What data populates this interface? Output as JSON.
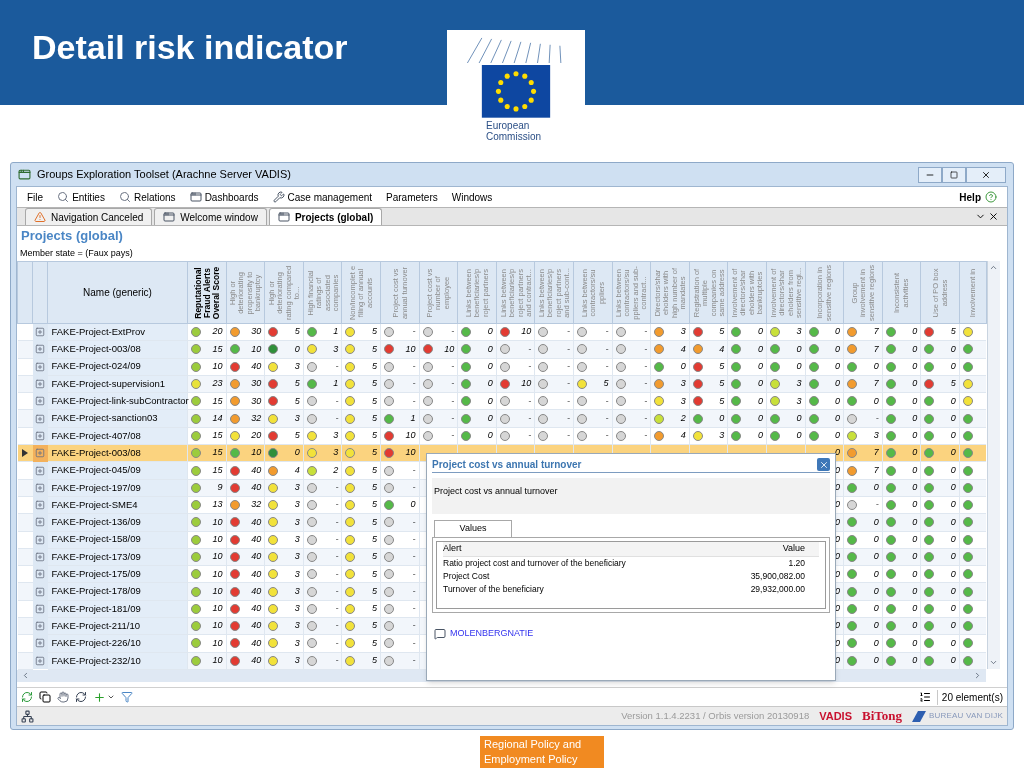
{
  "slide": {
    "title": "Detail risk indicator",
    "logo_text": "European Commission",
    "footer": "Regional Policy and Employment Policy"
  },
  "window": {
    "title": "Groups Exploration Toolset (Arachne Server VADIS)"
  },
  "menu": [
    {
      "label": "File",
      "kind": "plain"
    },
    {
      "label": "Entities",
      "kind": "search"
    },
    {
      "label": "Relations",
      "kind": "search"
    },
    {
      "label": "Dashboards",
      "kind": "window"
    },
    {
      "label": "Case management",
      "kind": "tools"
    },
    {
      "label": "Parameters",
      "kind": "plain"
    },
    {
      "label": "Windows",
      "kind": "plain"
    }
  ],
  "help": "Help",
  "tabs": [
    {
      "label": "Navigation Canceled",
      "kind": "alert",
      "selected": false
    },
    {
      "label": "Welcome window",
      "kind": "window",
      "selected": false
    },
    {
      "label": "Projects (global)",
      "kind": "window",
      "selected": true
    }
  ],
  "view": {
    "title": "Projects (global)",
    "filter": "Member state = (Faux pays)"
  },
  "table": {
    "name_column": "Name (generic)",
    "columns": [
      {
        "label": "Reputational Fraud Alerts Overal Score",
        "kind": "score"
      },
      {
        "label": "High or deteriorating propensity to bankruptcy",
        "kind": "indicator"
      },
      {
        "label": "High or deteriorating rating compared to...",
        "kind": "indicator"
      },
      {
        "label": "High financial ratings of associated companies",
        "kind": "indicator"
      },
      {
        "label": "Non/incomplet e filing of annual accounts",
        "kind": "indicator"
      },
      {
        "label": "Project cost vs annual turnover",
        "kind": "indicator"
      },
      {
        "label": "Project cost vs number of employee",
        "kind": "indicator"
      },
      {
        "label": "Links between beneficiaries/p roject partners",
        "kind": "indicator"
      },
      {
        "label": "Links between beneficiaries/p roject partners and contract...",
        "kind": "indicator"
      },
      {
        "label": "Links between beneficiaries/p roject partners and sub-cont...",
        "kind": "indicator"
      },
      {
        "label": "Links between contractors/su ppliers",
        "kind": "indicator"
      },
      {
        "label": "Links between contractors/su ppliers and sub-contract...",
        "kind": "indicator"
      },
      {
        "label": "Directors/shar eholders with high number of mandates",
        "kind": "indicator"
      },
      {
        "label": "Registration of multiple companies on same address",
        "kind": "indicator"
      },
      {
        "label": "Involvement of directors/shar eholders with bankruptcies",
        "kind": "indicator"
      },
      {
        "label": "Involvement of directors/shar eholders from sensitive regi...",
        "kind": "indicator"
      },
      {
        "label": "Incorporation in sensitive regions",
        "kind": "indicator"
      },
      {
        "label": "Group involvement in sensitive regions",
        "kind": "indicator"
      },
      {
        "label": "Inconsistent activities",
        "kind": "indicator"
      },
      {
        "label": "Use of PO box address",
        "kind": "indicator"
      },
      {
        "label": "Involvement in",
        "kind": "indicator"
      }
    ],
    "rows": [
      {
        "name": "FAKE-Project-ExtProv",
        "selected": false,
        "cells": [
          {
            "color": "#9ccc3c",
            "value": "20"
          },
          {
            "color": "#f29b2e",
            "value": "30"
          },
          {
            "color": "#e23b32",
            "value": "5"
          },
          {
            "color": "#55b948",
            "value": "1"
          },
          {
            "color": "#f2e23a",
            "value": "5"
          },
          {
            "color": "#d6d6d6",
            "value": "-"
          },
          {
            "color": "#d6d6d6",
            "value": "-"
          },
          {
            "color": "#55b948",
            "value": "0"
          },
          {
            "color": "#e23b32",
            "value": "10"
          },
          {
            "color": "#d6d6d6",
            "value": "-"
          },
          {
            "color": "#d6d6d6",
            "value": "-"
          },
          {
            "color": "#d6d6d6",
            "value": "-"
          },
          {
            "color": "#f29b2e",
            "value": "3"
          },
          {
            "color": "#e23b32",
            "value": "5"
          },
          {
            "color": "#55b948",
            "value": "0"
          },
          {
            "color": "#c8e03a",
            "value": "3"
          },
          {
            "color": "#55b948",
            "value": "0"
          },
          {
            "color": "#f29b2e",
            "value": "7"
          },
          {
            "color": "#55b948",
            "value": "0"
          },
          {
            "color": "#e23b32",
            "value": "5"
          },
          {
            "color": "#f2e23a"
          }
        ]
      },
      {
        "name": "FAKE-Project-003/08",
        "selected": false,
        "cells": [
          {
            "color": "#9ccc3c",
            "value": "15"
          },
          {
            "color": "#55b948",
            "value": "10"
          },
          {
            "color": "#2f8f3a",
            "value": "0"
          },
          {
            "color": "#f2e23a",
            "value": "3"
          },
          {
            "color": "#f2e23a",
            "value": "5"
          },
          {
            "color": "#e23b32",
            "value": "10"
          },
          {
            "color": "#e23b32",
            "value": "10"
          },
          {
            "color": "#55b948",
            "value": "0"
          },
          {
            "color": "#d6d6d6",
            "value": "-"
          },
          {
            "color": "#d6d6d6",
            "value": "-"
          },
          {
            "color": "#d6d6d6",
            "value": "-"
          },
          {
            "color": "#d6d6d6",
            "value": "-"
          },
          {
            "color": "#f29b2e",
            "value": "4"
          },
          {
            "color": "#f29b2e",
            "value": "4"
          },
          {
            "color": "#55b948",
            "value": "0"
          },
          {
            "color": "#55b948",
            "value": "0"
          },
          {
            "color": "#55b948",
            "value": "0"
          },
          {
            "color": "#f29b2e",
            "value": "7"
          },
          {
            "color": "#55b948",
            "value": "0"
          },
          {
            "color": "#55b948",
            "value": "0"
          },
          {
            "color": "#55b948"
          }
        ]
      },
      {
        "name": "FAKE-Project-024/09",
        "selected": false,
        "cells": [
          {
            "color": "#9ccc3c",
            "value": "10"
          },
          {
            "color": "#e23b32",
            "value": "40"
          },
          {
            "color": "#f2e23a",
            "value": "3"
          },
          {
            "color": "#d6d6d6",
            "value": "-"
          },
          {
            "color": "#f2e23a",
            "value": "5"
          },
          {
            "color": "#d6d6d6",
            "value": "-"
          },
          {
            "color": "#d6d6d6",
            "value": "-"
          },
          {
            "color": "#55b948",
            "value": "0"
          },
          {
            "color": "#d6d6d6",
            "value": "-"
          },
          {
            "color": "#d6d6d6",
            "value": "-"
          },
          {
            "color": "#d6d6d6",
            "value": "-"
          },
          {
            "color": "#d6d6d6",
            "value": "-"
          },
          {
            "color": "#55b948",
            "value": "0"
          },
          {
            "color": "#e23b32",
            "value": "5"
          },
          {
            "color": "#55b948",
            "value": "0"
          },
          {
            "color": "#55b948",
            "value": "0"
          },
          {
            "color": "#55b948",
            "value": "0"
          },
          {
            "color": "#55b948",
            "value": "0"
          },
          {
            "color": "#55b948",
            "value": "0"
          },
          {
            "color": "#55b948",
            "value": "0"
          },
          {
            "color": "#55b948"
          }
        ]
      },
      {
        "name": "FAKE-Project-supervision1",
        "selected": false,
        "cells": [
          {
            "color": "#e8e23a",
            "value": "23"
          },
          {
            "color": "#f29b2e",
            "value": "30"
          },
          {
            "color": "#e23b32",
            "value": "5"
          },
          {
            "color": "#55b948",
            "value": "1"
          },
          {
            "color": "#f2e23a",
            "value": "5"
          },
          {
            "color": "#d6d6d6",
            "value": "-"
          },
          {
            "color": "#d6d6d6",
            "value": "-"
          },
          {
            "color": "#55b948",
            "value": "0"
          },
          {
            "color": "#e23b32",
            "value": "10"
          },
          {
            "color": "#d6d6d6",
            "value": "-"
          },
          {
            "color": "#f2e23a",
            "value": "5"
          },
          {
            "color": "#d6d6d6",
            "value": "-"
          },
          {
            "color": "#f29b2e",
            "value": "3"
          },
          {
            "color": "#e23b32",
            "value": "5"
          },
          {
            "color": "#55b948",
            "value": "0"
          },
          {
            "color": "#c8e03a",
            "value": "3"
          },
          {
            "color": "#55b948",
            "value": "0"
          },
          {
            "color": "#f29b2e",
            "value": "7"
          },
          {
            "color": "#55b948",
            "value": "0"
          },
          {
            "color": "#e23b32",
            "value": "5"
          },
          {
            "color": "#f2e23a"
          }
        ]
      },
      {
        "name": "FAKE-Project-link-subContractor",
        "selected": false,
        "cells": [
          {
            "color": "#9ccc3c",
            "value": "15"
          },
          {
            "color": "#f29b2e",
            "value": "30"
          },
          {
            "color": "#e23b32",
            "value": "5"
          },
          {
            "color": "#d6d6d6",
            "value": "-"
          },
          {
            "color": "#f2e23a",
            "value": "5"
          },
          {
            "color": "#d6d6d6",
            "value": "-"
          },
          {
            "color": "#d6d6d6",
            "value": "-"
          },
          {
            "color": "#55b948",
            "value": "0"
          },
          {
            "color": "#d6d6d6",
            "value": "-"
          },
          {
            "color": "#d6d6d6",
            "value": "-"
          },
          {
            "color": "#d6d6d6",
            "value": "-"
          },
          {
            "color": "#d6d6d6",
            "value": "-"
          },
          {
            "color": "#f2e23a",
            "value": "3"
          },
          {
            "color": "#e23b32",
            "value": "5"
          },
          {
            "color": "#55b948",
            "value": "0"
          },
          {
            "color": "#c8e03a",
            "value": "3"
          },
          {
            "color": "#55b948",
            "value": "0"
          },
          {
            "color": "#55b948",
            "value": "0"
          },
          {
            "color": "#55b948",
            "value": "0"
          },
          {
            "color": "#55b948",
            "value": "0"
          },
          {
            "color": "#f2e23a"
          }
        ]
      },
      {
        "name": "FAKE-Project-sanction03",
        "selected": false,
        "cells": [
          {
            "color": "#9ccc3c",
            "value": "14"
          },
          {
            "color": "#f29b2e",
            "value": "32"
          },
          {
            "color": "#f2e23a",
            "value": "3"
          },
          {
            "color": "#d6d6d6",
            "value": "-"
          },
          {
            "color": "#f2e23a",
            "value": "5"
          },
          {
            "color": "#55b948",
            "value": "1"
          },
          {
            "color": "#d6d6d6",
            "value": "-"
          },
          {
            "color": "#55b948",
            "value": "0"
          },
          {
            "color": "#d6d6d6",
            "value": "-"
          },
          {
            "color": "#d6d6d6",
            "value": "-"
          },
          {
            "color": "#d6d6d6",
            "value": "-"
          },
          {
            "color": "#d6d6d6",
            "value": "-"
          },
          {
            "color": "#c8e03a",
            "value": "2"
          },
          {
            "color": "#55b948",
            "value": "0"
          },
          {
            "color": "#55b948",
            "value": "0"
          },
          {
            "color": "#55b948",
            "value": "0"
          },
          {
            "color": "#55b948",
            "value": "0"
          },
          {
            "color": "#d6d6d6",
            "value": "-"
          },
          {
            "color": "#55b948",
            "value": "0"
          },
          {
            "color": "#55b948",
            "value": "0"
          },
          {
            "color": "#55b948"
          }
        ]
      },
      {
        "name": "FAKE-Project-407/08",
        "selected": false,
        "cells": [
          {
            "color": "#9ccc3c",
            "value": "15"
          },
          {
            "color": "#f2e23a",
            "value": "20"
          },
          {
            "color": "#e23b32",
            "value": "5"
          },
          {
            "color": "#f2e23a",
            "value": "3"
          },
          {
            "color": "#f2e23a",
            "value": "5"
          },
          {
            "color": "#e23b32",
            "value": "10"
          },
          {
            "color": "#d6d6d6",
            "value": "-"
          },
          {
            "color": "#55b948",
            "value": "0"
          },
          {
            "color": "#d6d6d6",
            "value": "-"
          },
          {
            "color": "#d6d6d6",
            "value": "-"
          },
          {
            "color": "#d6d6d6",
            "value": "-"
          },
          {
            "color": "#d6d6d6",
            "value": "-"
          },
          {
            "color": "#f29b2e",
            "value": "4"
          },
          {
            "color": "#f2e23a",
            "value": "3"
          },
          {
            "color": "#55b948",
            "value": "0"
          },
          {
            "color": "#55b948",
            "value": "0"
          },
          {
            "color": "#55b948",
            "value": "0"
          },
          {
            "color": "#c8e03a",
            "value": "3"
          },
          {
            "color": "#55b948",
            "value": "0"
          },
          {
            "color": "#55b948",
            "value": "0"
          },
          {
            "color": "#55b948"
          }
        ]
      },
      {
        "name": "FAKE-Project-003/08",
        "selected": true,
        "cells": [
          {
            "color": "#9ccc3c",
            "value": "15"
          },
          {
            "color": "#55b948",
            "value": "10"
          },
          {
            "color": "#2f8f3a",
            "value": "0"
          },
          {
            "color": "#f2e23a",
            "value": "3"
          },
          {
            "color": "#f2e23a",
            "value": "5"
          },
          {
            "color": "#e23b32",
            "value": "10"
          },
          null,
          null,
          null,
          null,
          null,
          null,
          null,
          null,
          null,
          null,
          {
            "value": "0"
          },
          {
            "color": "#f29b2e",
            "value": "7"
          },
          {
            "color": "#55b948",
            "value": "0"
          },
          {
            "color": "#55b948",
            "value": "0"
          },
          {
            "color": "#55b948"
          }
        ]
      },
      {
        "name": "FAKE-Project-045/09",
        "selected": false,
        "cells": [
          {
            "color": "#9ccc3c",
            "value": "15"
          },
          {
            "color": "#e23b32",
            "value": "40"
          },
          {
            "color": "#f29b2e",
            "value": "4"
          },
          {
            "color": "#c8e03a",
            "value": "2"
          },
          {
            "color": "#f2e23a",
            "value": "5"
          },
          {
            "color": "#d6d6d6",
            "value": "-"
          },
          null,
          null,
          null,
          null,
          null,
          null,
          null,
          null,
          null,
          null,
          {
            "value": "0"
          },
          {
            "color": "#f29b2e",
            "value": "7"
          },
          {
            "color": "#55b948",
            "value": "0"
          },
          {
            "color": "#55b948",
            "value": "0"
          },
          {
            "color": "#55b948"
          }
        ]
      },
      {
        "name": "FAKE-Project-197/09",
        "selected": false,
        "cells": [
          {
            "color": "#9ccc3c",
            "value": "9"
          },
          {
            "color": "#e23b32",
            "value": "40"
          },
          {
            "color": "#f2e23a",
            "value": "3"
          },
          {
            "color": "#d6d6d6",
            "value": "-"
          },
          {
            "color": "#f2e23a",
            "value": "5"
          },
          {
            "color": "#d6d6d6",
            "value": "-"
          },
          null,
          null,
          null,
          null,
          null,
          null,
          null,
          null,
          null,
          null,
          {
            "value": "0"
          },
          {
            "color": "#55b948",
            "value": "0"
          },
          {
            "color": "#55b948",
            "value": "0"
          },
          {
            "color": "#55b948",
            "value": "0"
          },
          {
            "color": "#55b948"
          }
        ]
      },
      {
        "name": "FAKE-Project-SME4",
        "selected": false,
        "cells": [
          {
            "color": "#9ccc3c",
            "value": "13"
          },
          {
            "color": "#f29b2e",
            "value": "32"
          },
          {
            "color": "#f2e23a",
            "value": "3"
          },
          {
            "color": "#d6d6d6",
            "value": "-"
          },
          {
            "color": "#f2e23a",
            "value": "5"
          },
          {
            "color": "#55b948",
            "value": "0"
          },
          null,
          null,
          null,
          null,
          null,
          null,
          null,
          null,
          null,
          null,
          {
            "value": "0"
          },
          {
            "color": "#d6d6d6",
            "value": "-"
          },
          {
            "color": "#55b948",
            "value": "0"
          },
          {
            "color": "#55b948",
            "value": "0"
          },
          {
            "color": "#55b948"
          }
        ]
      },
      {
        "name": "FAKE-Project-136/09",
        "selected": false,
        "cells": [
          {
            "color": "#9ccc3c",
            "value": "10"
          },
          {
            "color": "#e23b32",
            "value": "40"
          },
          {
            "color": "#f2e23a",
            "value": "3"
          },
          {
            "color": "#d6d6d6",
            "value": "-"
          },
          {
            "color": "#f2e23a",
            "value": "5"
          },
          {
            "color": "#d6d6d6",
            "value": "-"
          },
          null,
          null,
          null,
          null,
          null,
          null,
          null,
          null,
          null,
          null,
          {
            "value": "0"
          },
          {
            "color": "#55b948",
            "value": "0"
          },
          {
            "color": "#55b948",
            "value": "0"
          },
          {
            "color": "#55b948",
            "value": "0"
          },
          {
            "color": "#55b948"
          }
        ]
      },
      {
        "name": "FAKE-Project-158/09",
        "selected": false,
        "cells": [
          {
            "color": "#9ccc3c",
            "value": "10"
          },
          {
            "color": "#e23b32",
            "value": "40"
          },
          {
            "color": "#f2e23a",
            "value": "3"
          },
          {
            "color": "#d6d6d6",
            "value": "-"
          },
          {
            "color": "#f2e23a",
            "value": "5"
          },
          {
            "color": "#d6d6d6",
            "value": "-"
          },
          null,
          null,
          null,
          null,
          null,
          null,
          null,
          null,
          null,
          null,
          {
            "value": "0"
          },
          {
            "color": "#55b948",
            "value": "0"
          },
          {
            "color": "#55b948",
            "value": "0"
          },
          {
            "color": "#55b948",
            "value": "0"
          },
          {
            "color": "#55b948"
          }
        ]
      },
      {
        "name": "FAKE-Project-173/09",
        "selected": false,
        "cells": [
          {
            "color": "#9ccc3c",
            "value": "10"
          },
          {
            "color": "#e23b32",
            "value": "40"
          },
          {
            "color": "#f2e23a",
            "value": "3"
          },
          {
            "color": "#d6d6d6",
            "value": "-"
          },
          {
            "color": "#f2e23a",
            "value": "5"
          },
          {
            "color": "#d6d6d6",
            "value": "-"
          },
          null,
          null,
          null,
          null,
          null,
          null,
          null,
          null,
          null,
          null,
          {
            "value": "0"
          },
          {
            "color": "#55b948",
            "value": "0"
          },
          {
            "color": "#55b948",
            "value": "0"
          },
          {
            "color": "#55b948",
            "value": "0"
          },
          {
            "color": "#55b948"
          }
        ]
      },
      {
        "name": "FAKE-Project-175/09",
        "selected": false,
        "cells": [
          {
            "color": "#9ccc3c",
            "value": "10"
          },
          {
            "color": "#e23b32",
            "value": "40"
          },
          {
            "color": "#f2e23a",
            "value": "3"
          },
          {
            "color": "#d6d6d6",
            "value": "-"
          },
          {
            "color": "#f2e23a",
            "value": "5"
          },
          {
            "color": "#d6d6d6",
            "value": "-"
          },
          null,
          null,
          null,
          null,
          null,
          null,
          null,
          null,
          null,
          null,
          {
            "value": "0"
          },
          {
            "color": "#55b948",
            "value": "0"
          },
          {
            "color": "#55b948",
            "value": "0"
          },
          {
            "color": "#55b948",
            "value": "0"
          },
          {
            "color": "#55b948"
          }
        ]
      },
      {
        "name": "FAKE-Project-178/09",
        "selected": false,
        "cells": [
          {
            "color": "#9ccc3c",
            "value": "10"
          },
          {
            "color": "#e23b32",
            "value": "40"
          },
          {
            "color": "#f2e23a",
            "value": "3"
          },
          {
            "color": "#d6d6d6",
            "value": "-"
          },
          {
            "color": "#f2e23a",
            "value": "5"
          },
          {
            "color": "#d6d6d6",
            "value": "-"
          },
          null,
          null,
          null,
          null,
          null,
          null,
          null,
          null,
          null,
          null,
          {
            "value": "0"
          },
          {
            "color": "#55b948",
            "value": "0"
          },
          {
            "color": "#55b948",
            "value": "0"
          },
          {
            "color": "#55b948",
            "value": "0"
          },
          {
            "color": "#55b948"
          }
        ]
      },
      {
        "name": "FAKE-Project-181/09",
        "selected": false,
        "cells": [
          {
            "color": "#9ccc3c",
            "value": "10"
          },
          {
            "color": "#e23b32",
            "value": "40"
          },
          {
            "color": "#f2e23a",
            "value": "3"
          },
          {
            "color": "#d6d6d6",
            "value": "-"
          },
          {
            "color": "#f2e23a",
            "value": "5"
          },
          {
            "color": "#d6d6d6",
            "value": "-"
          },
          null,
          null,
          null,
          null,
          null,
          null,
          null,
          null,
          null,
          null,
          {
            "value": "0"
          },
          {
            "color": "#55b948",
            "value": "0"
          },
          {
            "color": "#55b948",
            "value": "0"
          },
          {
            "color": "#55b948",
            "value": "0"
          },
          {
            "color": "#55b948"
          }
        ]
      },
      {
        "name": "FAKE-Project-211/10",
        "selected": false,
        "cells": [
          {
            "color": "#9ccc3c",
            "value": "10"
          },
          {
            "color": "#e23b32",
            "value": "40"
          },
          {
            "color": "#f2e23a",
            "value": "3"
          },
          {
            "color": "#d6d6d6",
            "value": "-"
          },
          {
            "color": "#f2e23a",
            "value": "5"
          },
          {
            "color": "#d6d6d6",
            "value": "-"
          },
          null,
          null,
          null,
          null,
          null,
          null,
          null,
          null,
          null,
          null,
          {
            "value": "0"
          },
          {
            "color": "#55b948",
            "value": "0"
          },
          {
            "color": "#55b948",
            "value": "0"
          },
          {
            "color": "#55b948",
            "value": "0"
          },
          {
            "color": "#55b948"
          }
        ]
      },
      {
        "name": "FAKE-Project-226/10",
        "selected": false,
        "cells": [
          {
            "color": "#9ccc3c",
            "value": "10"
          },
          {
            "color": "#e23b32",
            "value": "40"
          },
          {
            "color": "#f2e23a",
            "value": "3"
          },
          {
            "color": "#d6d6d6",
            "value": "-"
          },
          {
            "color": "#f2e23a",
            "value": "5"
          },
          {
            "color": "#d6d6d6",
            "value": "-"
          },
          null,
          null,
          null,
          null,
          null,
          null,
          null,
          null,
          null,
          null,
          {
            "value": "0"
          },
          {
            "color": "#55b948",
            "value": "0"
          },
          {
            "color": "#55b948",
            "value": "0"
          },
          {
            "color": "#55b948",
            "value": "0"
          },
          {
            "color": "#55b948"
          }
        ]
      },
      {
        "name": "FAKE-Project-232/10",
        "selected": false,
        "cells": [
          {
            "color": "#9ccc3c",
            "value": "10"
          },
          {
            "color": "#e23b32",
            "value": "40"
          },
          {
            "color": "#f2e23a",
            "value": "3"
          },
          {
            "color": "#d6d6d6",
            "value": "-"
          },
          {
            "color": "#f2e23a",
            "value": "5"
          },
          {
            "color": "#d6d6d6",
            "value": "-"
          },
          null,
          null,
          null,
          null,
          null,
          null,
          null,
          null,
          null,
          null,
          {
            "value": "0"
          },
          {
            "color": "#55b948",
            "value": "0"
          },
          {
            "color": "#55b948",
            "value": "0"
          },
          {
            "color": "#55b948",
            "value": "0"
          },
          {
            "color": "#55b948"
          }
        ]
      }
    ]
  },
  "popup": {
    "title": "Project cost vs annual turnover",
    "description": "Project cost vs annual turnover",
    "tabs": [
      {
        "label": "Values",
        "selected": true
      }
    ],
    "columns": [
      "Alert",
      "Value"
    ],
    "rows": [
      {
        "alert": "Ratio project cost and turnover of the beneficiary",
        "value": "1.20"
      },
      {
        "alert": "Project Cost",
        "value": "35,900,082.00"
      },
      {
        "alert": "Turnover of the beneficiary",
        "value": "29,932,000.00"
      }
    ],
    "link": "MOLENBERGNATIE"
  },
  "toolbar": {
    "count": "20 element(s)"
  },
  "status_bar": {
    "version": "Version 1.1.4.2231 / Orbis version 20130918",
    "logos": [
      {
        "label": "VADIS",
        "kind": "vadis"
      },
      {
        "label": "BiTong",
        "kind": "bitong"
      },
      {
        "label": "BUREAU VAN DIJK",
        "kind": "bvd"
      }
    ]
  }
}
